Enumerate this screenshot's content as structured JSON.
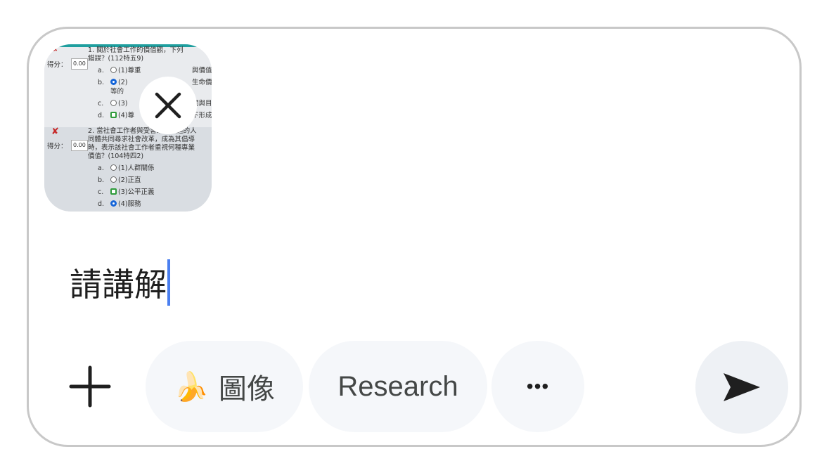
{
  "attachment": {
    "q1_title_line1": "1. 關於社會工作的價值觀，下列",
    "q1_title_line2": "錯誤？(112特五9)",
    "q1_score_label": "得分：",
    "q1_score_value": "0.00",
    "q1_options": [
      {
        "letter": "a.",
        "text": "(1)尊重"
      },
      {
        "letter": "b.",
        "text": "(2)"
      },
      {
        "letter": "",
        "text": "等的"
      },
      {
        "letter": "c.",
        "text": "(3)"
      },
      {
        "letter": "d.",
        "text": "(4)尊"
      }
    ],
    "q1_right_fragments": [
      "與價值",
      "生命價",
      "關與目",
      "下形成"
    ],
    "q2_title_line1": "2. 當社會工作者與受害或被壓迫的人",
    "q2_title_line2": "同體共同尋求社會改革，成為其倡導",
    "q2_title_line3": "時，表示該社會工作者重視何種專業",
    "q2_title_line4": "價值？(104特四2)",
    "q2_score_label": "得分：",
    "q2_score_value": "0.00",
    "q2_options": [
      {
        "letter": "a.",
        "text": "(1)人群關係"
      },
      {
        "letter": "b.",
        "text": "(2)正直"
      },
      {
        "letter": "c.",
        "text": "(3)公平正義"
      },
      {
        "letter": "d.",
        "text": "(4)服務"
      }
    ],
    "remove_icon": "close-icon"
  },
  "prompt": {
    "text": "請講解"
  },
  "toolbar": {
    "add_icon": "plus-icon",
    "image_chip_emoji": "🍌",
    "image_chip_label": "圖像",
    "research_chip_label": "Research",
    "more_label": "•••",
    "send_icon": "send-arrow-icon"
  },
  "colors": {
    "border": "#c8c8c8",
    "chip_bg": "#f5f7fa",
    "send_bg": "#eef1f5",
    "caret": "#4a7ff0"
  }
}
